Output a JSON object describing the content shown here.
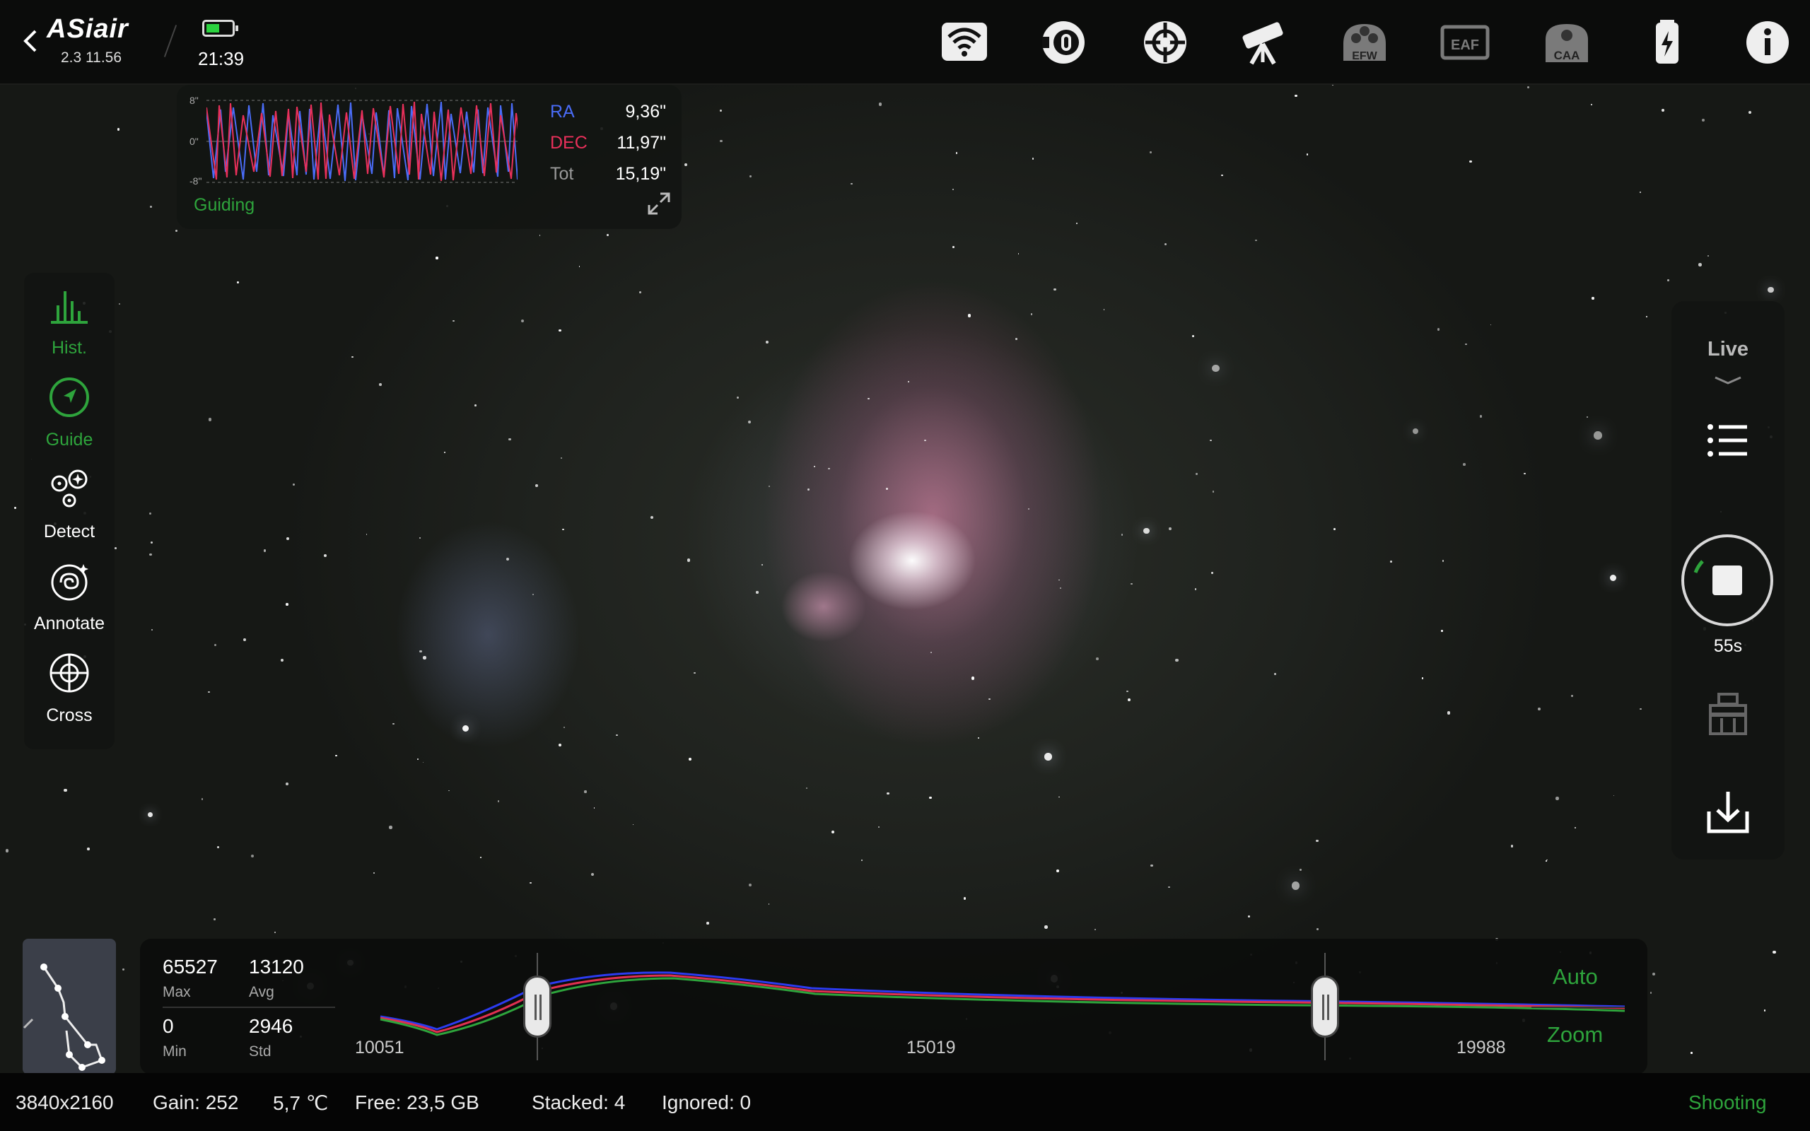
{
  "app": {
    "brand": "ASiair",
    "version": "2.3 11.56",
    "time": "21:39",
    "battery_level": 0.45
  },
  "topbar": {
    "icons": [
      "wifi-icon",
      "camera-icon",
      "guide-scope-icon",
      "telescope-icon",
      "efw-icon",
      "eaf-icon",
      "caa-icon",
      "usb-power-icon",
      "info-icon"
    ],
    "efw_label": "EFW",
    "eaf_label": "EAF",
    "caa_label": "CAA"
  },
  "guide": {
    "scale_top": "8\"",
    "scale_mid": "0\"",
    "scale_bot": "-8\"",
    "ra_label": "RA",
    "ra_value": "9,36\"",
    "dec_label": "DEC",
    "dec_value": "11,97\"",
    "tot_label": "Tot",
    "tot_value": "15,19\"",
    "status": "Guiding",
    "colors": {
      "ra": "#4a6cf7",
      "dec": "#e8305a",
      "active": "#2ea43c"
    }
  },
  "left_tools": [
    {
      "label": "Hist.",
      "active": true
    },
    {
      "label": "Guide",
      "active": true
    },
    {
      "label": "Detect",
      "active": false
    },
    {
      "label": "Annotate",
      "active": false
    },
    {
      "label": "Cross",
      "active": false
    }
  ],
  "right_tools": {
    "mode": "Live",
    "timer": "55s"
  },
  "histogram": {
    "max_value": "65527",
    "max_label": "Max",
    "avg_value": "13120",
    "avg_label": "Avg",
    "min_value": "0",
    "min_label": "Min",
    "std_value": "2946",
    "std_label": "Std",
    "axis_left": "10051",
    "axis_mid": "15019",
    "axis_right": "19988",
    "auto_label": "Auto",
    "zoom_label": "Zoom"
  },
  "status_bar": {
    "resolution": "3840x2160",
    "gain": "Gain: 252",
    "temperature": "5,7 ℃",
    "free": "Free: 23,5 GB",
    "stacked": "Stacked: 4",
    "ignored": "Ignored: 0",
    "state": "Shooting"
  }
}
